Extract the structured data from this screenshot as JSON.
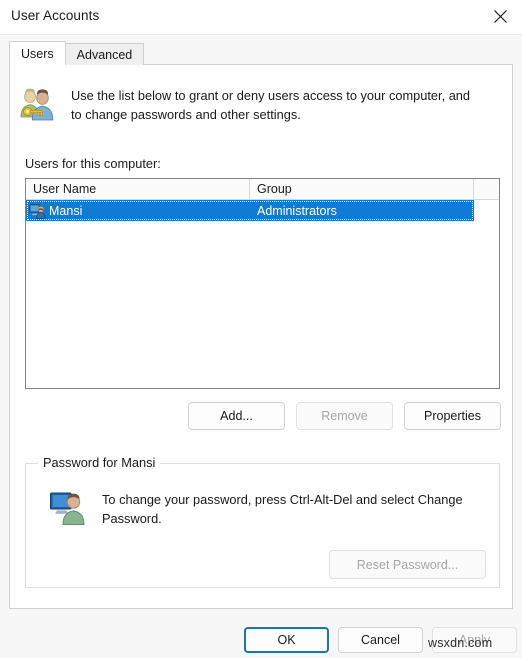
{
  "window": {
    "title": "User Accounts",
    "close_icon": "close-icon"
  },
  "tabs": [
    {
      "label": "Users",
      "active": true
    },
    {
      "label": "Advanced",
      "active": false
    }
  ],
  "intro": {
    "icon": "users-with-key-icon",
    "text": "Use the list below to grant or deny users access to your computer, and to change passwords and other settings."
  },
  "list": {
    "label": "Users for this computer:",
    "columns": [
      "User Name",
      "Group",
      ""
    ],
    "rows": [
      {
        "icon": "user-computer-icon",
        "user_name": "Mansi",
        "group": "Administrators",
        "selected": true
      }
    ]
  },
  "actions": {
    "add": {
      "label": "Add...",
      "disabled": false
    },
    "remove": {
      "label": "Remove",
      "disabled": true
    },
    "properties": {
      "label": "Properties",
      "disabled": false
    }
  },
  "password_group": {
    "legend": "Password for Mansi",
    "icon": "user-computer-icon",
    "text": "To change your password, press Ctrl-Alt-Del and select Change Password.",
    "reset_button": {
      "label": "Reset Password...",
      "disabled": true
    }
  },
  "footer": {
    "ok": {
      "label": "OK",
      "disabled": false,
      "default": true
    },
    "cancel": {
      "label": "Cancel",
      "disabled": false
    },
    "apply": {
      "label": "Apply",
      "disabled": true
    }
  },
  "watermark": "wsxdn.com",
  "colors": {
    "selection": "#0f7bd4",
    "default_button_border": "#1a74b8",
    "dialog_background": "#f7f7f7",
    "page_background": "#ffffff"
  }
}
